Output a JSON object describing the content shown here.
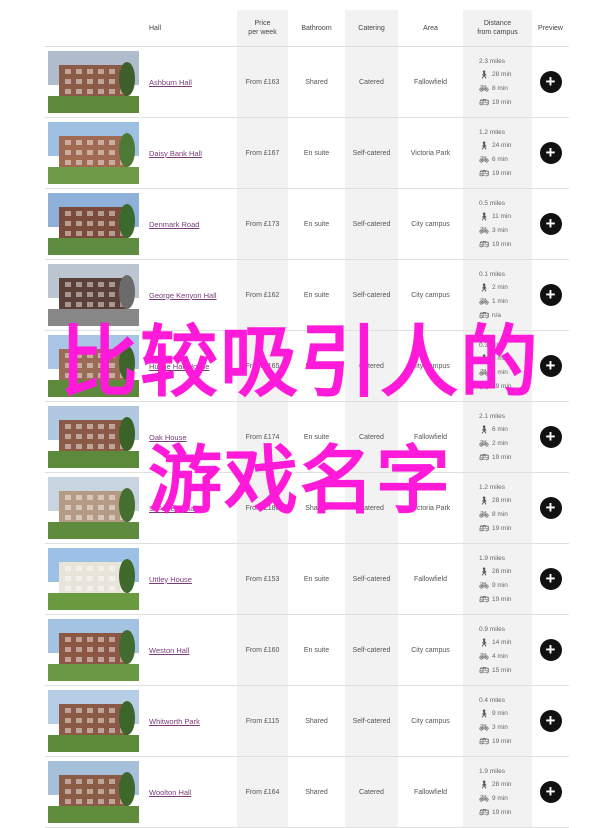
{
  "header": {
    "hall": "Hall",
    "price_l1": "Price",
    "price_l2": "per week",
    "bathroom": "Bathroom",
    "catering": "Catering",
    "area": "Area",
    "distance_l1": "Distance",
    "distance_l2": "from campus",
    "preview": "Preview"
  },
  "rows": [
    {
      "name": "Ashburn Hall",
      "price": "From £163",
      "bathroom": "Shared",
      "catering": "Catered",
      "area": "Fallowfield",
      "walk": "2.3 miles",
      "cycle": "28 min",
      "bike": "8 min",
      "bus": "19 min",
      "colors": {
        "sky": "#aebccc",
        "bld": "#8c5b47",
        "lawn": "#5f8a3c",
        "tree": "#3e5e2c"
      }
    },
    {
      "name": "Daisy Bank Hall",
      "price": "From £167",
      "bathroom": "En suite",
      "catering": "Self-catered",
      "area": "Victoria Park",
      "walk": "1.2 miles",
      "cycle": "24 min",
      "bike": "6 min",
      "bus": "19 min",
      "colors": {
        "sky": "#9fc0e0",
        "bld": "#a06a52",
        "lawn": "#6f9a48",
        "tree": "#4c7a36"
      }
    },
    {
      "name": "Denmark Road",
      "price": "From £173",
      "bathroom": "En suite",
      "catering": "Self-catered",
      "area": "City campus",
      "walk": "0.5 miles",
      "cycle": "11 min",
      "bike": "3 min",
      "bus": "19 min",
      "colors": {
        "sky": "#8fb0d8",
        "bld": "#7a4a3a",
        "lawn": "#5e8c40",
        "tree": "#3b6a2e"
      }
    },
    {
      "name": "George Kenyon Hall",
      "price": "From £162",
      "bathroom": "En suite",
      "catering": "Self-catered",
      "area": "City campus",
      "walk": "0.1 miles",
      "cycle": "2 min",
      "bike": "1 min",
      "bus": "n/a",
      "colors": {
        "sky": "#bcc6d0",
        "bld": "#5a4038",
        "lawn": "#888888",
        "tree": "#6b6b6b"
      }
    },
    {
      "name": "Hulme Hall House",
      "price": "From £165",
      "bathroom": "Shared",
      "catering": "Catered",
      "area": "City campus",
      "walk": "0.3 miles",
      "cycle": "6 min",
      "bike": "2 min",
      "bus": "19 min",
      "colors": {
        "sky": "#a9c4e4",
        "bld": "#9a6b55",
        "lawn": "#5c8a3a",
        "tree": "#3d652b"
      }
    },
    {
      "name": "Oak House",
      "price": "From £174",
      "bathroom": "En suite",
      "catering": "Catered",
      "area": "Fallowfield",
      "walk": "2.1 miles",
      "cycle": "6 min",
      "bike": "2 min",
      "bus": "19 min",
      "colors": {
        "sky": "#b0c8e0",
        "bld": "#8a5a46",
        "lawn": "#5a8a3a",
        "tree": "#3a6229"
      }
    },
    {
      "name": "St Anselm Hall",
      "price": "From £180",
      "bathroom": "Shared",
      "catering": "Catered",
      "area": "Victoria Park",
      "walk": "1.2 miles",
      "cycle": "28 min",
      "bike": "8 min",
      "bus": "19 min",
      "colors": {
        "sky": "#c8d4e0",
        "bld": "#b59a86",
        "lawn": "#5f8b3e",
        "tree": "#456e31"
      }
    },
    {
      "name": "Uttley House",
      "price": "From £153",
      "bathroom": "En suite",
      "catering": "Self-catered",
      "area": "Fallowfield",
      "walk": "1.9 miles",
      "cycle": "28 min",
      "bike": "9 min",
      "bus": "19 min",
      "colors": {
        "sky": "#9cc0e6",
        "bld": "#e8e4da",
        "lawn": "#6a9a40",
        "tree": "#3f6a2c"
      }
    },
    {
      "name": "Weston Hall",
      "price": "From £160",
      "bathroom": "En suite",
      "catering": "Self-catered",
      "area": "City campus",
      "walk": "0.9 miles",
      "cycle": "14 min",
      "bike": "4 min",
      "bus": "15 min",
      "colors": {
        "sky": "#a4c2e2",
        "bld": "#8c5644",
        "lawn": "#6b9a45",
        "tree": "#426c2f"
      }
    },
    {
      "name": "Whitworth Park",
      "price": "From £115",
      "bathroom": "Shared",
      "catering": "Self-catered",
      "area": "City campus",
      "walk": "0.4 miles",
      "cycle": "9 min",
      "bike": "3 min",
      "bus": "19 min",
      "colors": {
        "sky": "#b6cde6",
        "bld": "#8a5a46",
        "lawn": "#5c8c3a",
        "tree": "#3c6529"
      }
    },
    {
      "name": "Woolton Hall",
      "price": "From £164",
      "bathroom": "Shared",
      "catering": "Catered",
      "area": "Fallowfield",
      "walk": "1.9 miles",
      "cycle": "28 min",
      "bike": "9 min",
      "bus": "19 min",
      "colors": {
        "sky": "#a6c0dc",
        "bld": "#8a5c46",
        "lawn": "#5f8d3c",
        "tree": "#3d672b"
      }
    }
  ],
  "icons": {
    "walk": "walking-person-icon",
    "cycle": "bicycle-icon",
    "bike": "bicycle-icon",
    "bus": "bus-icon",
    "preview": "plus-icon"
  },
  "overlay": {
    "line1": "比较吸引人的",
    "line2": "游戏名字"
  }
}
